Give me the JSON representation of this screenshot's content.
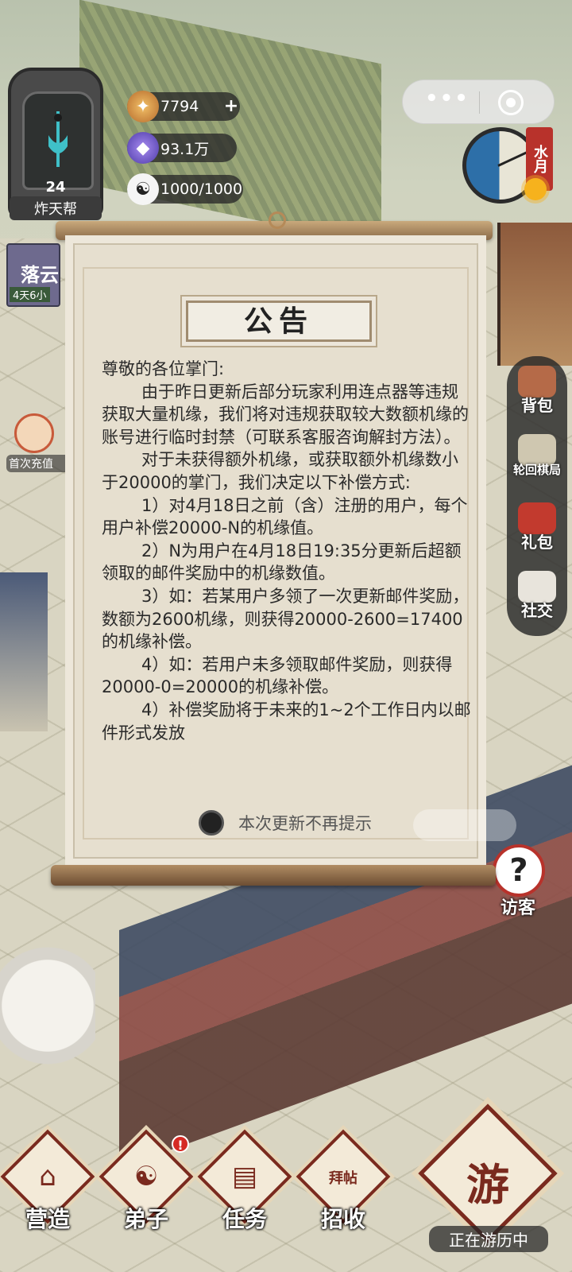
{
  "sect": {
    "level": "24",
    "name": "炸天帮"
  },
  "resources": {
    "spirit": "7794",
    "spirit_add": "+",
    "crystal": "93.1万",
    "stamina": "1000/1000"
  },
  "time_of_day": {
    "tag": "水月"
  },
  "event": {
    "title": "落云",
    "timer": "4天6小"
  },
  "first_charge": {
    "label": "首次充值"
  },
  "side_menu": [
    {
      "label": "背包",
      "icon": "backpack-icon"
    },
    {
      "label": "轮回棋局",
      "icon": "chessboard-icon"
    },
    {
      "label": "礼包",
      "icon": "gift-icon"
    },
    {
      "label": "社交",
      "icon": "social-icon"
    }
  ],
  "visitor": {
    "label": "访客",
    "icon": "question-icon"
  },
  "notice": {
    "title": "公告",
    "greeting": "尊敬的各位掌门:",
    "paragraphs": [
      "由于昨日更新后部分玩家利用连点器等违规获取大量机缘，我们将对违规获取较大数额机缘的账号进行临时封禁（可联系客服咨询解封方法）。",
      "对于未获得额外机缘，或获取额外机缘数小于20000的掌门，我们决定以下补偿方式:",
      "1）对4月18日之前（含）注册的用户，每个用户补偿20000-N的机缘值。",
      "2）N为用户在4月18日19:35分更新后超额领取的邮件奖励中的机缘数值。",
      "3）如：若某用户多领了一次更新邮件奖励，数额为2600机缘，则获得20000-2600=17400的机缘补偿。",
      "4）如：若用户未多领取邮件奖励，则获得20000-0=20000的机缘补偿。",
      "4）补偿奖励将于未来的1~2个工作日内以邮件形式发放"
    ],
    "dont_show_label": "本次更新不再提示"
  },
  "bottom_nav": [
    {
      "label": "营造",
      "glyph": "⌂",
      "icon": "pavilion-icon",
      "badge": ""
    },
    {
      "label": "弟子",
      "glyph": "☯",
      "icon": "disciple-icon",
      "badge": "!"
    },
    {
      "label": "任务",
      "glyph": "▤",
      "icon": "scroll-icon",
      "badge": ""
    },
    {
      "label": "招收",
      "glyph": "拜帖",
      "icon": "invitation-card-icon",
      "badge": ""
    }
  ],
  "travel": {
    "label": "正在游历中",
    "glyph": "游",
    "icon": "cloud-swirl-icon"
  },
  "colors": {
    "accent_red": "#b8322b",
    "frame_brown": "#7a2a1e",
    "paper": "#e6dfcf"
  }
}
